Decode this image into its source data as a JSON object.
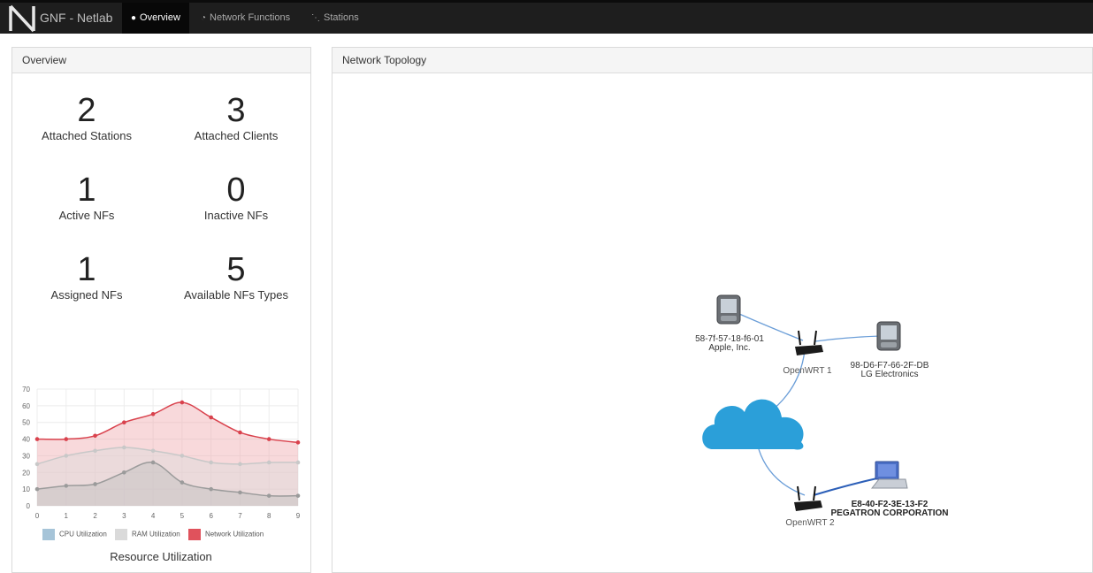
{
  "nav": {
    "brand": "GNF - Netlab",
    "items": [
      {
        "label": "Overview",
        "icon": "circle-icon",
        "active": true
      },
      {
        "label": "Network Functions",
        "icon": "dashboard-icon",
        "active": false
      },
      {
        "label": "Stations",
        "icon": "rss-icon",
        "active": false
      }
    ]
  },
  "overview": {
    "title": "Overview",
    "stats": [
      {
        "value": "2",
        "label": "Attached Stations"
      },
      {
        "value": "3",
        "label": "Attached Clients"
      },
      {
        "value": "1",
        "label": "Active NFs"
      },
      {
        "value": "0",
        "label": "Inactive NFs"
      },
      {
        "value": "1",
        "label": "Assigned NFs"
      },
      {
        "value": "5",
        "label": "Available NFs Types"
      }
    ]
  },
  "topology": {
    "title": "Network Topology",
    "nodes": {
      "station1": {
        "line1": "58-7f-57-18-f6-01",
        "line2": "Apple, Inc."
      },
      "router1": {
        "label": "OpenWRT 1"
      },
      "station2": {
        "line1": "98-D6-F7-66-2F-DB",
        "line2": "LG Electronics"
      },
      "router2": {
        "label": "OpenWRT 2"
      },
      "client": {
        "line1": "E8-40-F2-3E-13-F2",
        "line2": "PEGATRON CORPORATION"
      }
    }
  },
  "chart_data": {
    "type": "line",
    "title": "Resource Utilization",
    "x": [
      0,
      1,
      2,
      3,
      4,
      5,
      6,
      7,
      8,
      9
    ],
    "ylim": [
      0,
      70
    ],
    "yticks": [
      0,
      10,
      20,
      30,
      40,
      50,
      60,
      70
    ],
    "grid": true,
    "legend_position": "bottom",
    "series": [
      {
        "name": "CPU Utilization",
        "color": "#9b9b9b",
        "fill": "rgba(190,190,190,0.45)",
        "values": [
          10,
          12,
          13,
          20,
          26,
          14,
          10,
          8,
          6,
          6
        ]
      },
      {
        "name": "RAM Utilization",
        "color": "#c8c8c8",
        "fill": "rgba(220,220,220,0.45)",
        "values": [
          25,
          30,
          33,
          35,
          33,
          30,
          26,
          25,
          26,
          26
        ]
      },
      {
        "name": "Network Utilization",
        "color": "#d9424d",
        "fill": "rgba(240,170,175,0.45)",
        "values": [
          40,
          40,
          42,
          50,
          55,
          62,
          53,
          44,
          40,
          38
        ]
      }
    ],
    "legend_colors": {
      "CPU Utilization": "#a6c4d8",
      "RAM Utilization": "#dadada",
      "Network Utilization": "#e0525c"
    }
  }
}
